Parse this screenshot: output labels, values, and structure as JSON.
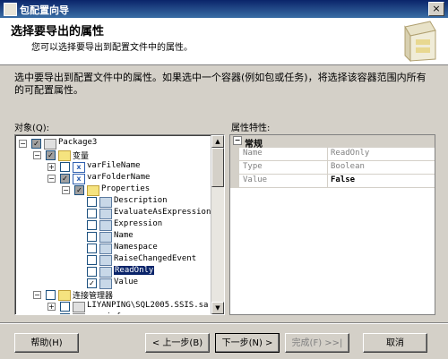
{
  "window": {
    "title": "包配置向导",
    "close_label": "×"
  },
  "header": {
    "title": "选择要导出的属性",
    "subtitle": "您可以选择要导出到配置文件中的属性。"
  },
  "description": "选中要导出到配置文件中的属性。如果选中一个容器(例如包或任务)，将选择该容器范围内所有的可配置属性。",
  "objects_label": "对象(Q):",
  "props_label": "属性特性:",
  "tree": {
    "package": "Package3",
    "variables": "变量",
    "var_file": "varFileName",
    "var_folder": "varFolderName",
    "properties": "Properties",
    "props": [
      "Description",
      "EvaluateAsExpression",
      "Expression",
      "Name",
      "Namespace",
      "RaiseChangedEvent",
      "ReadOnly",
      "Value"
    ],
    "selected": "ReadOnly",
    "checked": "Value",
    "conn_mgr": "连接管理器",
    "conn1": "LIYANPING\\SQL2005.SSIS.sa",
    "conn2": "pessinfo"
  },
  "properties_grid": {
    "category": "常规",
    "rows": [
      {
        "key": "Name",
        "value": "ReadOnly"
      },
      {
        "key": "Type",
        "value": "Boolean"
      },
      {
        "key": "Value",
        "value": "False"
      }
    ]
  },
  "buttons": {
    "help": "帮助(H)",
    "back": "< 上一步(B)",
    "next": "下一步(N) >",
    "finish": "完成(F) >>|",
    "cancel": "取消"
  },
  "colors": {
    "title_bar": "#0a246a",
    "selection": "#0a246a",
    "dialog_bg": "#d4d0c8"
  }
}
